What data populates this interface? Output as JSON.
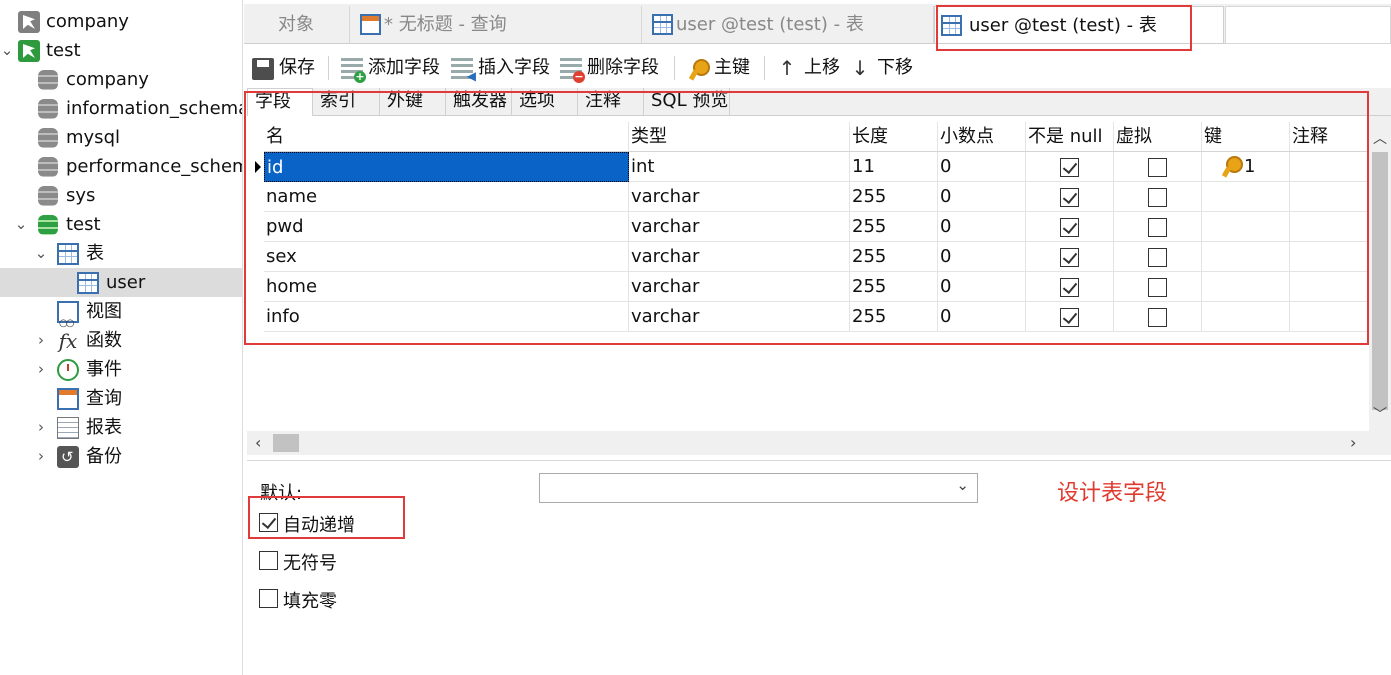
{
  "sidebar": {
    "items": [
      {
        "label": "company",
        "icon": "connection-icon"
      },
      {
        "label": "test",
        "icon": "connection-icon"
      },
      {
        "label": "company",
        "icon": "database-icon"
      },
      {
        "label": "information_schema",
        "icon": "database-icon"
      },
      {
        "label": "mysql",
        "icon": "database-icon"
      },
      {
        "label": "performance_schema",
        "icon": "database-icon"
      },
      {
        "label": "sys",
        "icon": "database-icon"
      },
      {
        "label": "test",
        "icon": "database-icon"
      },
      {
        "label": "表",
        "icon": "table-folder-icon"
      },
      {
        "label": "user",
        "icon": "table-icon"
      },
      {
        "label": "视图",
        "icon": "view-icon"
      },
      {
        "label": "函数",
        "icon": "function-icon"
      },
      {
        "label": "事件",
        "icon": "event-icon"
      },
      {
        "label": "查询",
        "icon": "query-icon"
      },
      {
        "label": "报表",
        "icon": "report-icon"
      },
      {
        "label": "备份",
        "icon": "backup-icon"
      }
    ]
  },
  "tabs": [
    {
      "label": "对象"
    },
    {
      "label": "* 无标题 - 查询"
    },
    {
      "label": "user @test (test) - 表"
    },
    {
      "label": "user @test (test) - 表"
    }
  ],
  "toolbar": {
    "save": "保存",
    "add_field": "添加字段",
    "insert_field": "插入字段",
    "delete_field": "删除字段",
    "primary_key": "主键",
    "move_up": "上移",
    "move_down": "下移"
  },
  "inner_tabs": [
    "字段",
    "索引",
    "外键",
    "触发器",
    "选项",
    "注释",
    "SQL 预览"
  ],
  "grid": {
    "columns": [
      "名",
      "类型",
      "长度",
      "小数点",
      "不是 null",
      "虚拟",
      "键",
      "注释"
    ],
    "rows": [
      {
        "name": "id",
        "type": "int",
        "length": "11",
        "decimals": "0",
        "not_null": true,
        "virtual": false,
        "key": "1"
      },
      {
        "name": "name",
        "type": "varchar",
        "length": "255",
        "decimals": "0",
        "not_null": true,
        "virtual": false,
        "key": ""
      },
      {
        "name": "pwd",
        "type": "varchar",
        "length": "255",
        "decimals": "0",
        "not_null": true,
        "virtual": false,
        "key": ""
      },
      {
        "name": "sex",
        "type": "varchar",
        "length": "255",
        "decimals": "0",
        "not_null": true,
        "virtual": false,
        "key": ""
      },
      {
        "name": "home",
        "type": "varchar",
        "length": "255",
        "decimals": "0",
        "not_null": true,
        "virtual": false,
        "key": ""
      },
      {
        "name": "info",
        "type": "varchar",
        "length": "255",
        "decimals": "0",
        "not_null": true,
        "virtual": false,
        "key": ""
      }
    ]
  },
  "properties": {
    "default_label": "默认:",
    "default_value": "",
    "auto_increment": {
      "label": "自动递增",
      "checked": true
    },
    "unsigned": {
      "label": "无符号",
      "checked": false
    },
    "zerofill": {
      "label": "填充零",
      "checked": false
    }
  },
  "annotation": "设计表字段",
  "colors": {
    "selection": "#0a64c8",
    "highlight_box": "#e03a3a",
    "annotation": "#e03a2f"
  }
}
